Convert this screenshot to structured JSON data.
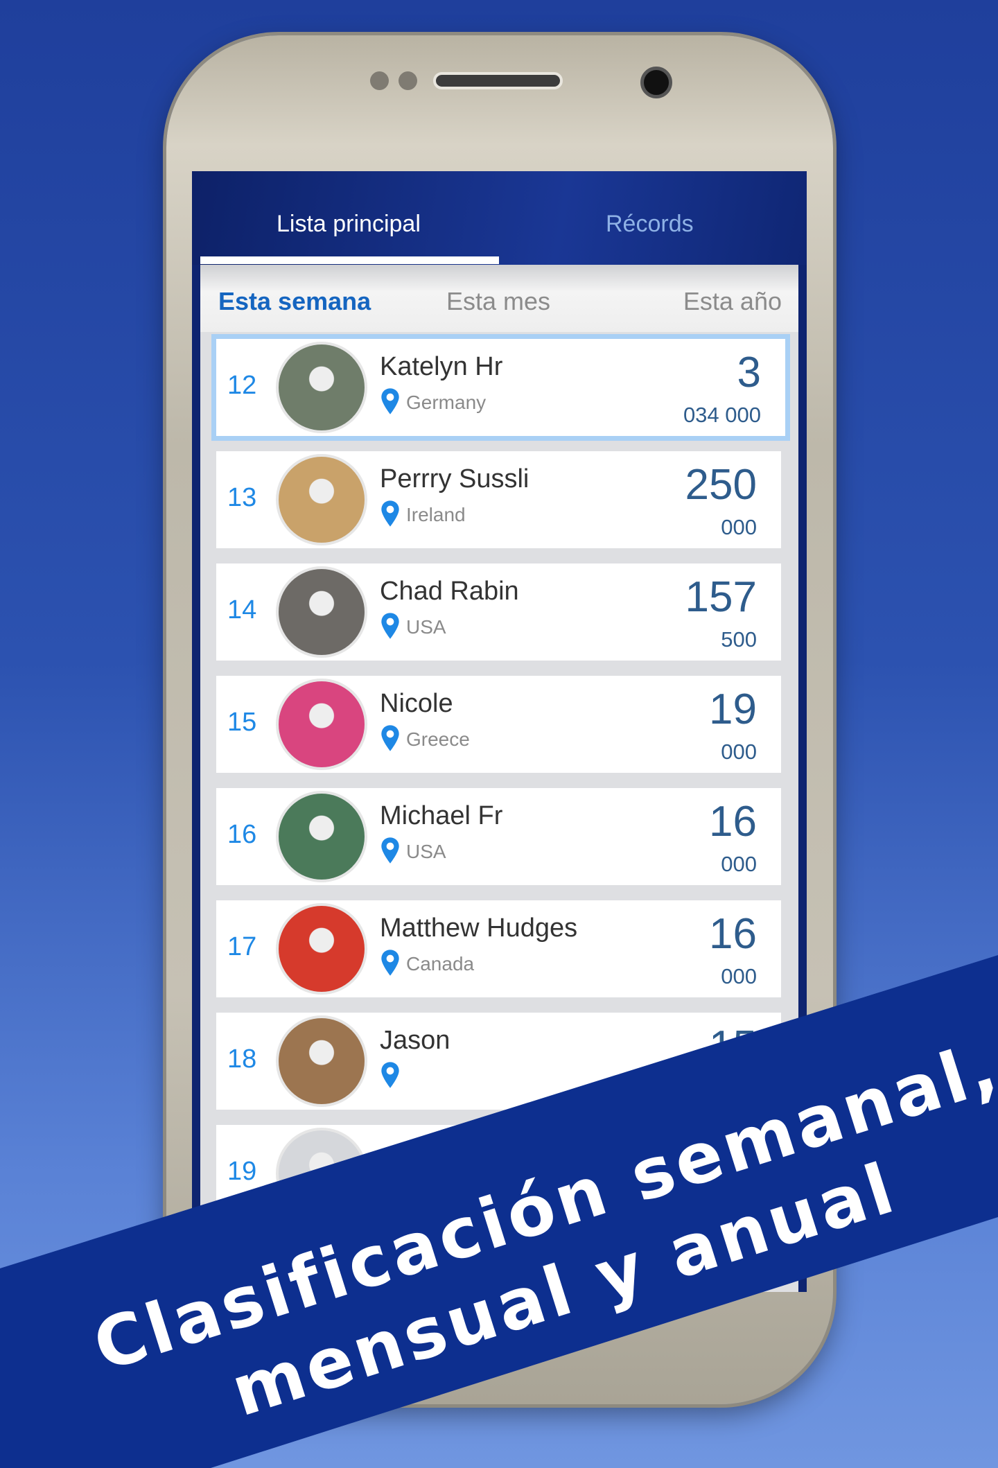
{
  "tabs": [
    {
      "label": "Lista principal",
      "active": true
    },
    {
      "label": "Récords",
      "active": false
    }
  ],
  "subtabs": [
    {
      "label": "Esta semana",
      "active": true
    },
    {
      "label": "Esta mes",
      "active": false
    },
    {
      "label": "Esta año",
      "active": false
    }
  ],
  "rows": [
    {
      "rank": "12",
      "name": "Katelyn Hr",
      "country": "Germany",
      "score_main": "3",
      "score_sub": "034 000",
      "highlighted": true,
      "avatar_color": "#6f7d6a"
    },
    {
      "rank": "13",
      "name": "Perrry Sussli",
      "country": "Ireland",
      "score_main": "250",
      "score_sub": "000",
      "avatar_color": "#c9a26a"
    },
    {
      "rank": "14",
      "name": "Chad Rabin",
      "country": "USA",
      "score_main": "157",
      "score_sub": "500",
      "avatar_color": "#6d6a66"
    },
    {
      "rank": "15",
      "name": "Nicole",
      "country": "Greece",
      "score_main": "19",
      "score_sub": "000",
      "avatar_color": "#d9457f"
    },
    {
      "rank": "16",
      "name": "Michael Fr",
      "country": "USA",
      "score_main": "16",
      "score_sub": "000",
      "avatar_color": "#4b7a5a"
    },
    {
      "rank": "17",
      "name": "Matthew Hudges",
      "country": "Canada",
      "score_main": "16",
      "score_sub": "000",
      "avatar_color": "#d63a2c"
    },
    {
      "rank": "18",
      "name": "Jason",
      "country": "",
      "score_main": "15",
      "score_sub": "",
      "avatar_color": "#9c7550"
    },
    {
      "rank": "19",
      "name": "",
      "country": "",
      "score_main": "",
      "score_sub": "",
      "avatar_color": "#d5d7db"
    }
  ],
  "banner": {
    "line1": "Clasificación semanal,",
    "line2": "mensual y anual"
  },
  "colors": {
    "accent": "#1e88e5",
    "header": "#0e2470",
    "banner": "#0d2f8f",
    "score": "#2e5c8c"
  }
}
